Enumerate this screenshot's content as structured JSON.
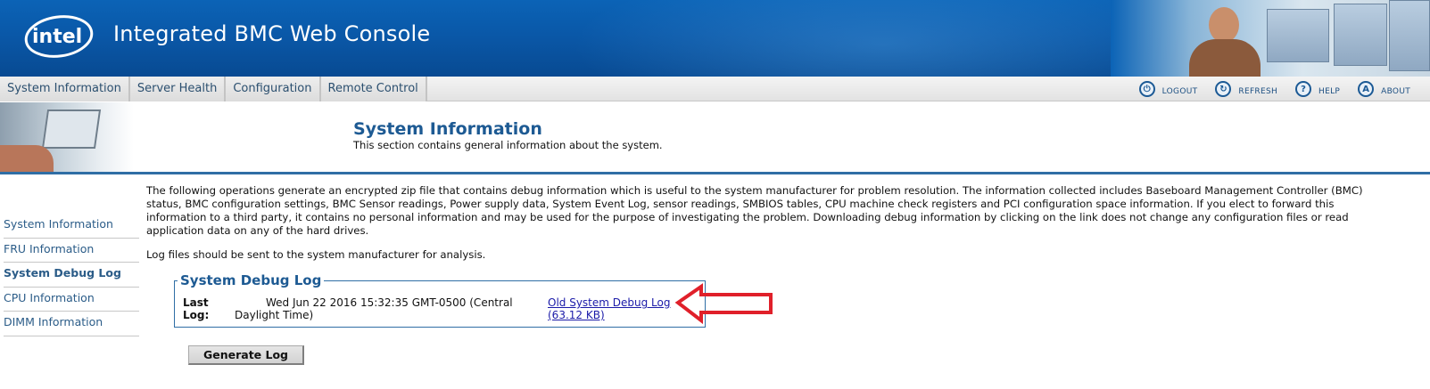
{
  "header": {
    "logo_text": "intel",
    "title": "Integrated BMC Web Console"
  },
  "nav": {
    "tabs": [
      {
        "label": "System Information"
      },
      {
        "label": "Server Health"
      },
      {
        "label": "Configuration"
      },
      {
        "label": "Remote Control"
      }
    ],
    "actions": [
      {
        "label": "LOGOUT",
        "icon": "logout-icon",
        "glyph": "⏻"
      },
      {
        "label": "REFRESH",
        "icon": "refresh-icon",
        "glyph": "↻"
      },
      {
        "label": "HELP",
        "icon": "help-icon",
        "glyph": "?"
      },
      {
        "label": "ABOUT",
        "icon": "about-icon",
        "glyph": "A"
      }
    ]
  },
  "section": {
    "title": "System Information",
    "description": "This section contains general information about the system."
  },
  "sidebar": {
    "items": [
      {
        "label": "System Information",
        "active": false
      },
      {
        "label": "FRU Information",
        "active": false
      },
      {
        "label": "System Debug Log",
        "active": true
      },
      {
        "label": "CPU Information",
        "active": false
      },
      {
        "label": "DIMM Information",
        "active": false
      }
    ]
  },
  "main": {
    "intro": "The following operations generate an encrypted zip file that contains debug information which is useful to the system manufacturer for problem resolution. The information collected includes Baseboard Management Controller (BMC) status, BMC configuration settings, BMC Sensor readings, Power supply data, System Event Log, sensor readings, SMBIOS tables, CPU machine check registers and PCI configuration space information. If you elect to forward this information to a third party, it contains no personal information and may be used for the purpose of investigating the problem. Downloading debug information by clicking on the link does not change any configuration files or read application data on any of the hard drives.",
    "note": "Log files should be sent to the system manufacturer for analysis.",
    "debug_box": {
      "legend": "System Debug Log",
      "last_log_label": "Last Log:",
      "last_log_value_line1": "Wed Jun 22 2016 15:32:35 GMT-0500 (Central",
      "last_log_value_line2": "Daylight Time)",
      "link_label": "Old System Debug Log (63.12 KB)"
    },
    "generate_button": "Generate Log"
  },
  "colors": {
    "banner": "#0a58a8",
    "accent": "#1d5a93",
    "link": "#1a1aa8",
    "annotation_arrow": "#e0202a"
  }
}
